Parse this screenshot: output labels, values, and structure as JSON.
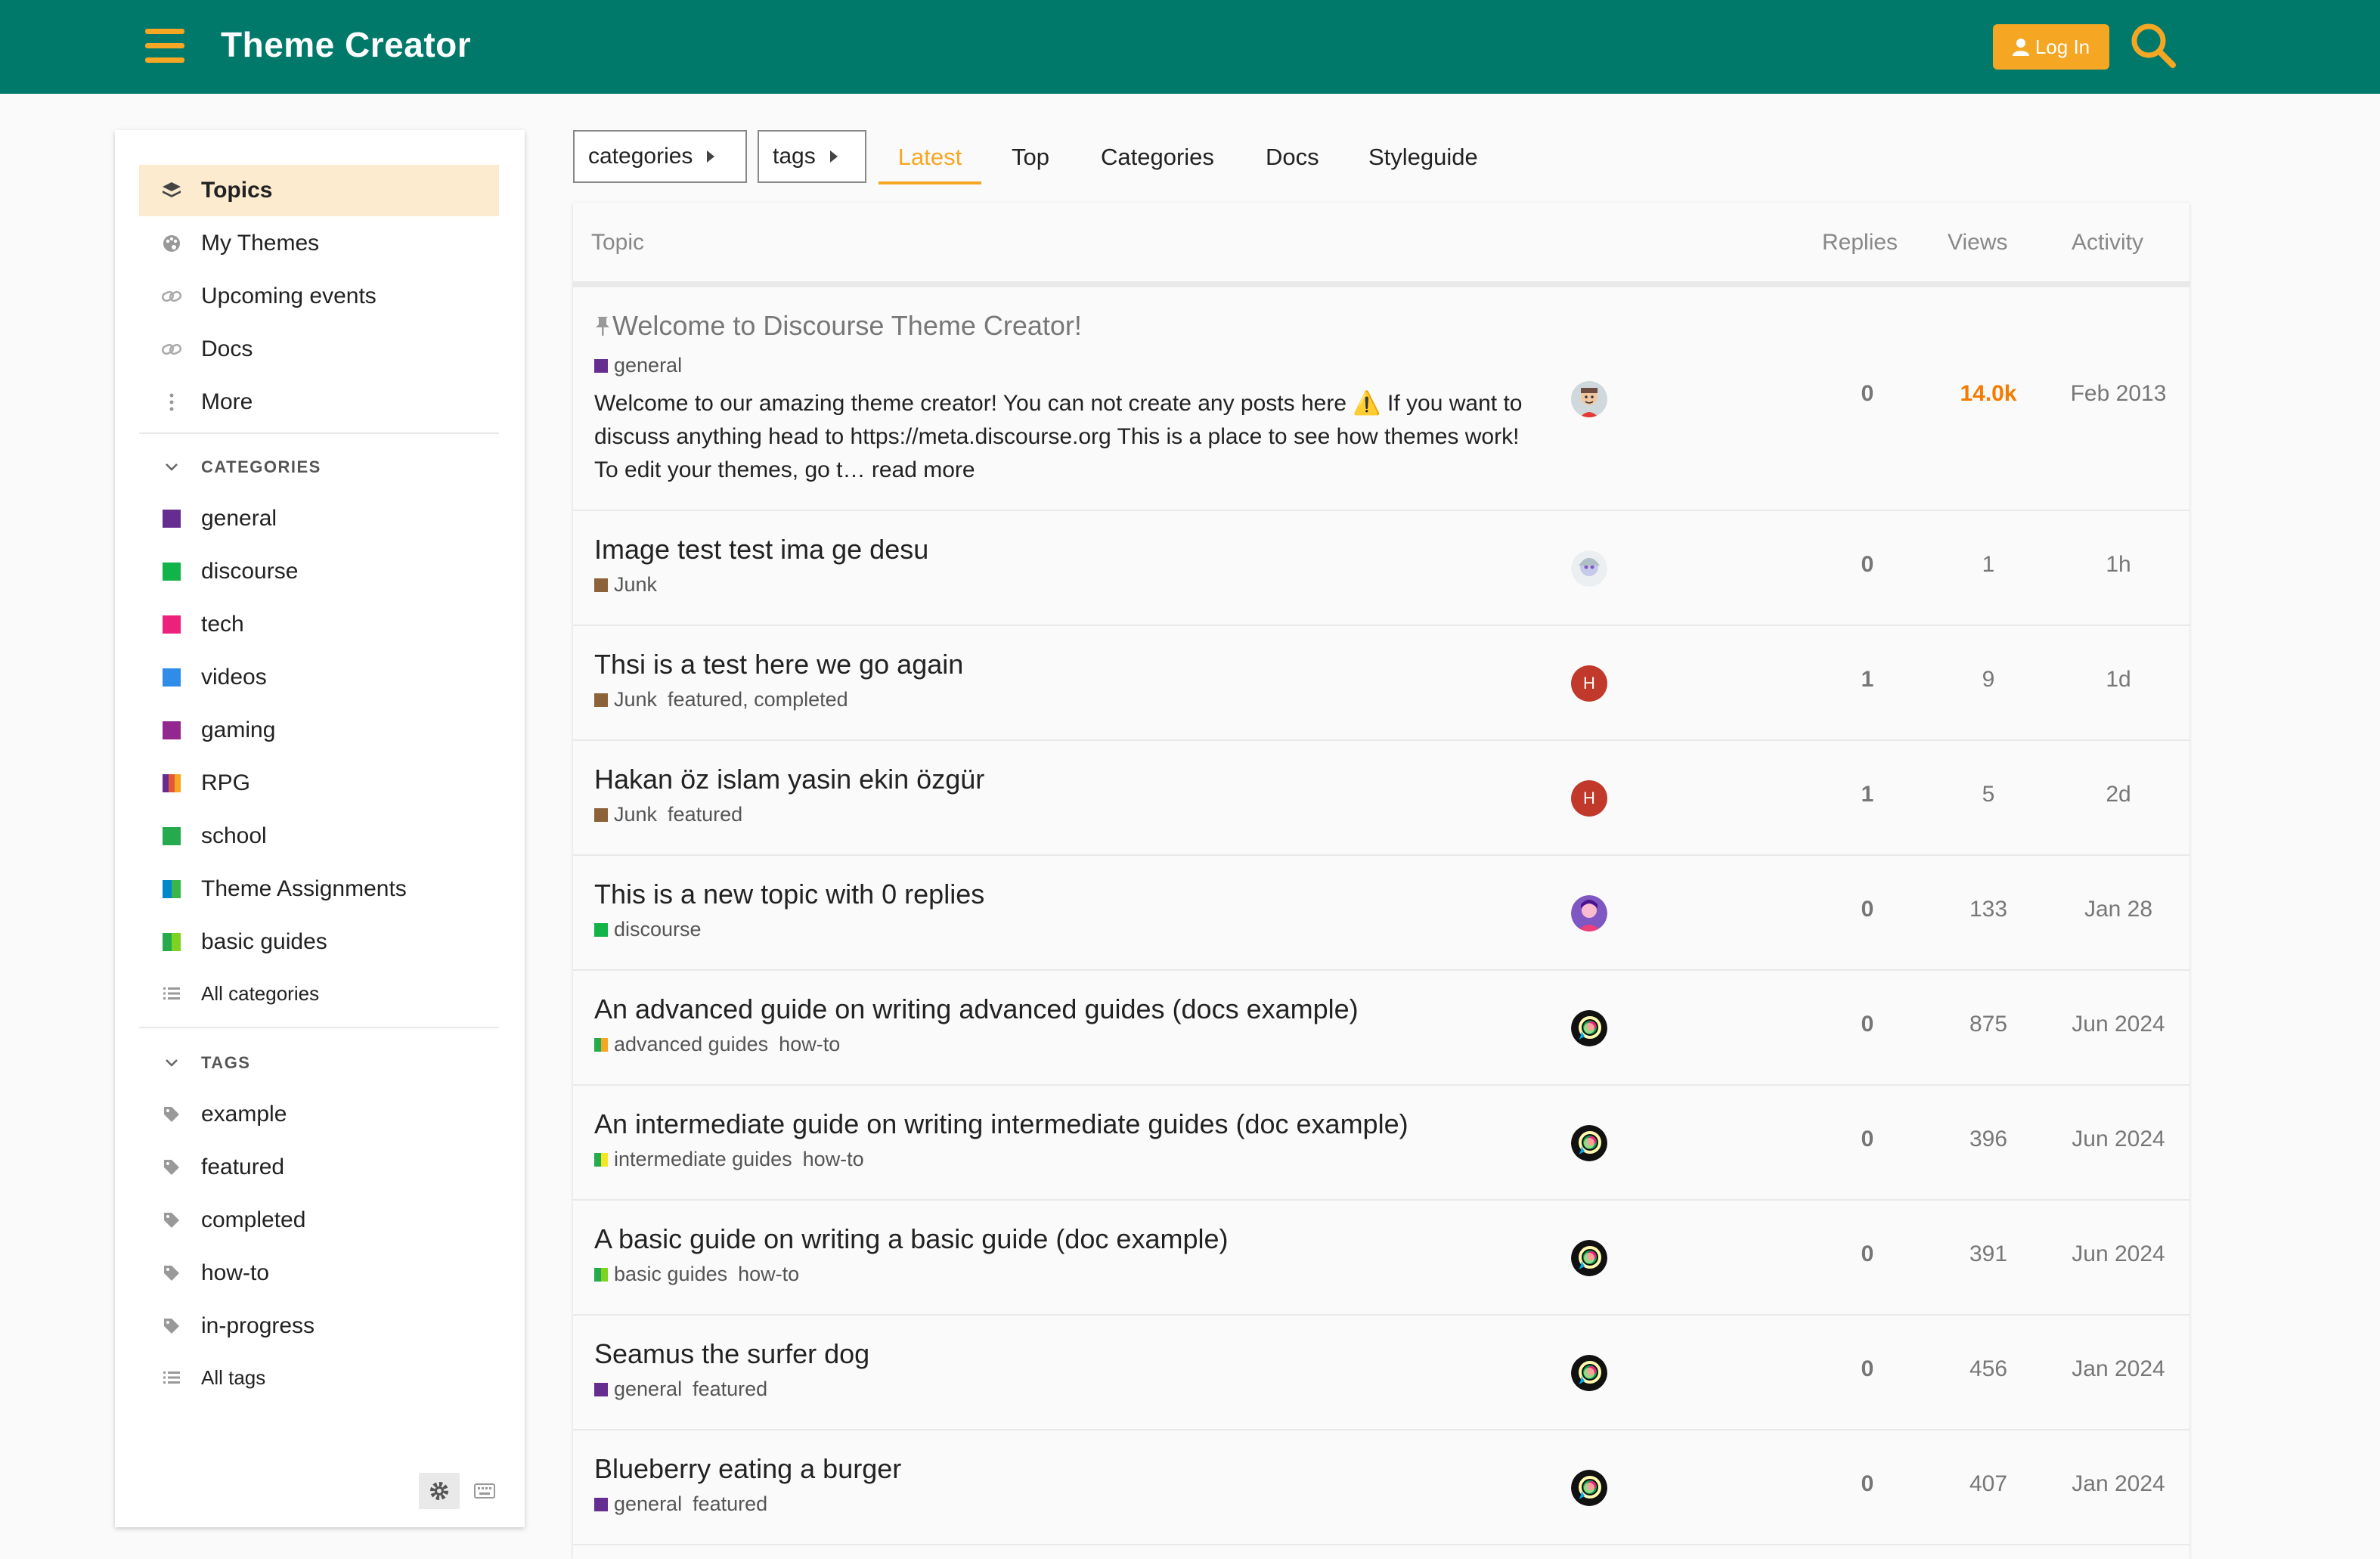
{
  "header": {
    "title": "Theme Creator",
    "login_label": "Log In",
    "accent": "#f5a623",
    "bg": "#00796b"
  },
  "sidebar": {
    "nav": [
      {
        "label": "Topics",
        "icon": "layers-icon"
      },
      {
        "label": "My Themes",
        "icon": "palette-icon"
      },
      {
        "label": "Upcoming events",
        "icon": "link-icon"
      },
      {
        "label": "Docs",
        "icon": "link-icon"
      },
      {
        "label": "More",
        "icon": "more-vertical-icon"
      }
    ],
    "categories_heading": "CATEGORIES",
    "categories": [
      {
        "label": "general",
        "color": "#652d90"
      },
      {
        "label": "discourse",
        "color": "#12a89d"
      },
      {
        "label": "tech",
        "color": "#ed207b"
      },
      {
        "label": "videos",
        "color": "#2980b9"
      },
      {
        "label": "gaming",
        "color": "#92278f"
      },
      {
        "label": "RPG",
        "color": "#e45735"
      },
      {
        "label": "school",
        "color": "#25aa4d"
      },
      {
        "label": "Theme Assignments",
        "color": "#0088cc"
      },
      {
        "label": "basic guides",
        "color": "#3ab54a"
      }
    ],
    "all_categories": "All categories",
    "tags_heading": "TAGS",
    "tags": [
      "example",
      "featured",
      "completed",
      "how-to",
      "in-progress"
    ],
    "all_tags": "All tags"
  },
  "nav": {
    "categories_drop": "categories",
    "tags_drop": "tags",
    "tabs": [
      "Latest",
      "Top",
      "Categories",
      "Docs",
      "Styleguide"
    ]
  },
  "list": {
    "headers": {
      "topic": "Topic",
      "replies": "Replies",
      "views": "Views",
      "activity": "Activity"
    },
    "topics": [
      {
        "title": "Welcome to Discourse Theme Creator!",
        "pinned": true,
        "category": "general",
        "category_color": "#652d90",
        "tags": "",
        "excerpt": "Welcome to our amazing theme creator! You can not create any posts here ⚠️ If you want to discuss anything head to https://meta.discourse.org This is a place to see how themes work! To edit your themes, go t…",
        "read_more": "read more",
        "replies": "0",
        "views": "14.0k",
        "activity": "Feb 2013"
      },
      {
        "title": "Image test test ima ge desu",
        "category": "Junk",
        "category_color": "#8c6238",
        "tags": "",
        "replies": "0",
        "views": "1",
        "activity": "1h"
      },
      {
        "title": "Thsi is a test here we go again",
        "category": "Junk",
        "category_color": "#8c6238",
        "tags": "featured, completed",
        "avatar_letter": "H",
        "replies": "1",
        "views": "9",
        "activity": "1d"
      },
      {
        "title": "Hakan öz islam yasin ekin özgür",
        "category": "Junk",
        "category_color": "#8c6238",
        "tags": "featured",
        "avatar_letter": "H",
        "replies": "1",
        "views": "5",
        "activity": "2d"
      },
      {
        "title": "This is a new topic with 0 replies",
        "category": "discourse",
        "category_color": "#12a89d",
        "tags": "",
        "replies": "0",
        "views": "133",
        "activity": "Jan 28"
      },
      {
        "title": "An advanced guide on writing advanced guides (docs example)",
        "category": "advanced guides",
        "category_color": "#3ab54a",
        "tags": "how-to",
        "replies": "0",
        "views": "875",
        "activity": "Jun 2024"
      },
      {
        "title": "An intermediate guide on writing intermediate guides (doc example)",
        "category": "intermediate guides",
        "category_color": "#3ab54a",
        "tags": "how-to",
        "replies": "0",
        "views": "396",
        "activity": "Jun 2024"
      },
      {
        "title": "A basic guide on writing a basic guide (doc example)",
        "category": "basic guides",
        "category_color": "#3ab54a",
        "tags": "how-to",
        "replies": "0",
        "views": "391",
        "activity": "Jun 2024"
      },
      {
        "title": "Seamus the surfer dog",
        "category": "general",
        "category_color": "#652d90",
        "tags": "featured",
        "replies": "0",
        "views": "456",
        "activity": "Jan 2024"
      },
      {
        "title": "Blueberry eating a burger",
        "category": "general",
        "category_color": "#652d90",
        "tags": "featured",
        "replies": "0",
        "views": "407",
        "activity": "Jan 2024"
      }
    ]
  }
}
